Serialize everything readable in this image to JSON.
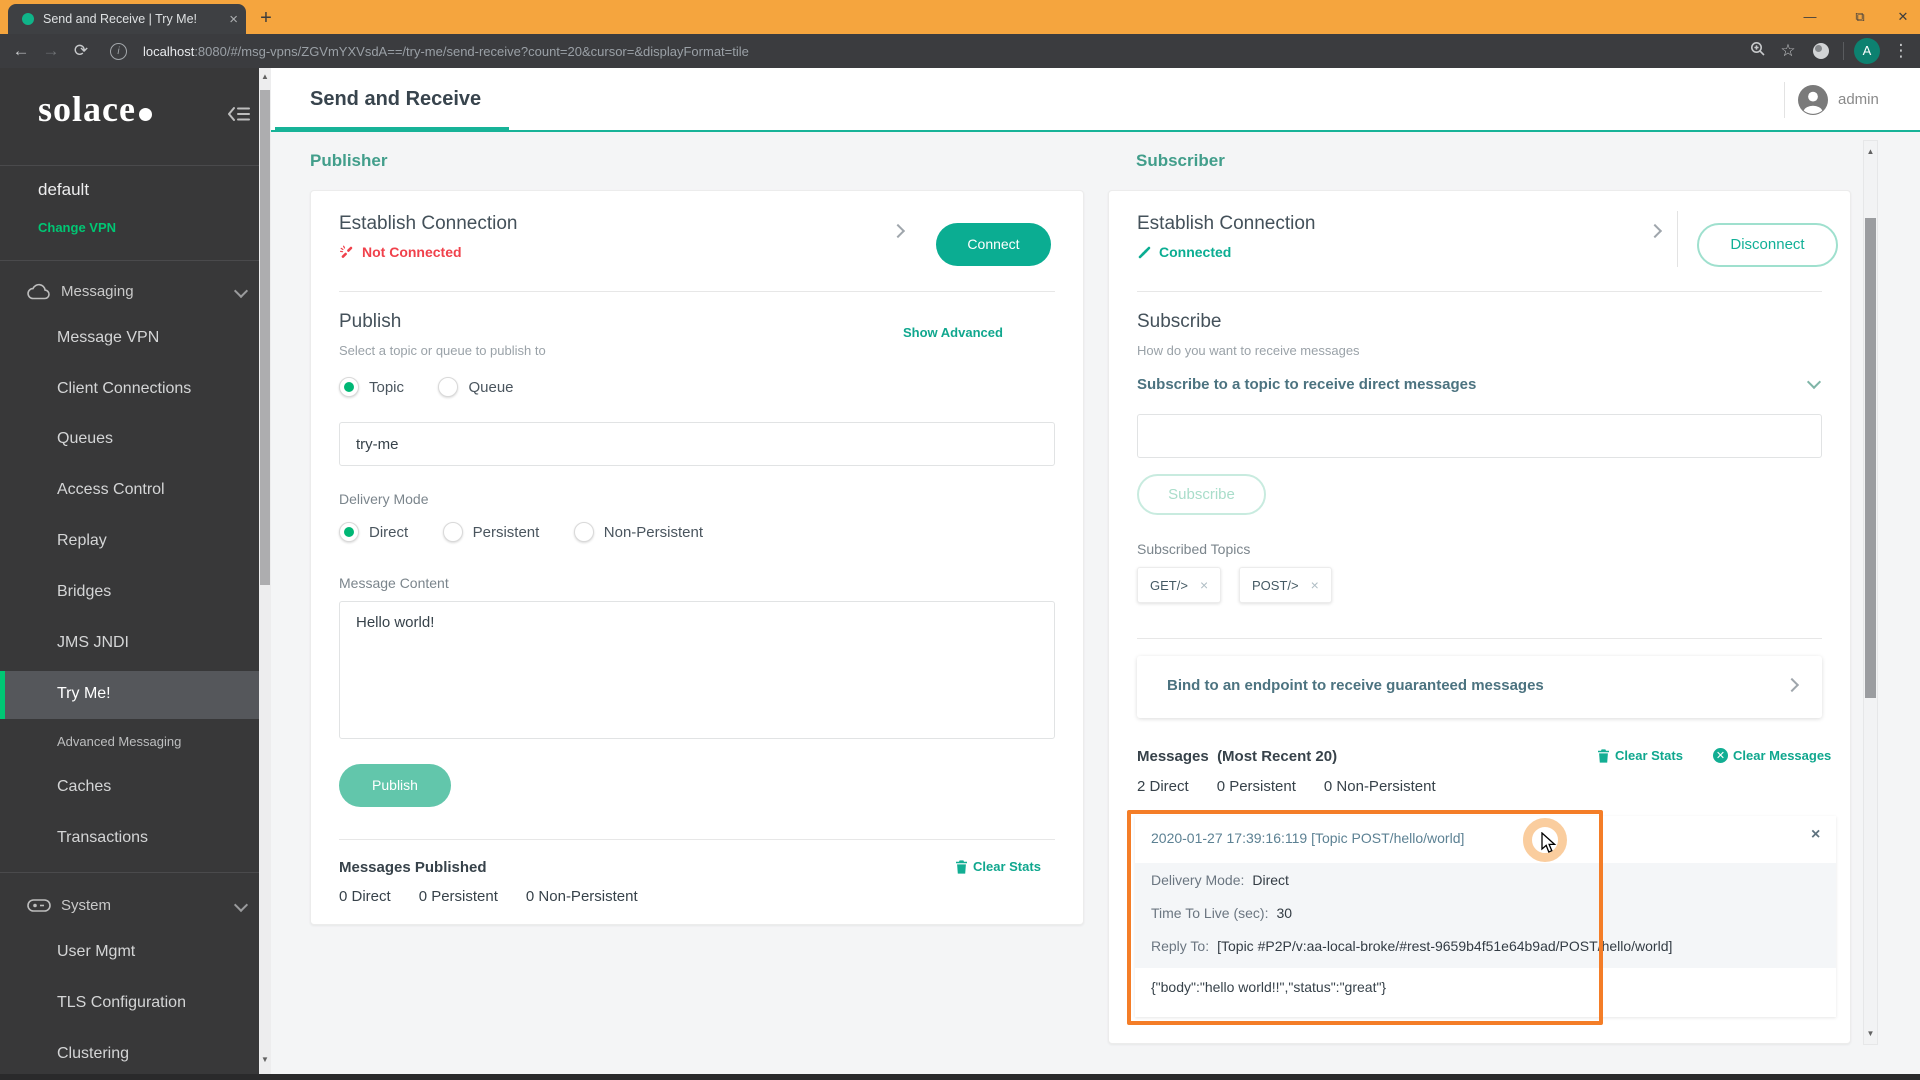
{
  "colors": {
    "accent_teal": "#0BAD92",
    "brand_green": "#00C774",
    "error_red": "#F0414B",
    "highlight_orange": "#F47D27",
    "header_underline": "#17B398",
    "chrome_orange": "#F5A53E"
  },
  "browser": {
    "tab_title": "Send and Receive | Try Me!",
    "url_host": "localhost",
    "url_rest": ":8080/#/msg-vpns/ZGVmYXVsdA==/try-me/send-receive?count=20&cursor=&displayFormat=tile",
    "profile_initial": "A"
  },
  "window_controls": {
    "minimize": "—",
    "maximize": "⧉",
    "close": "✕"
  },
  "icons": {
    "back": "←",
    "forward": "→",
    "reload": "⟳",
    "star": "☆",
    "menu_dots": "⋮",
    "new_tab": "+",
    "tab_close": "×",
    "close_x": "×",
    "scroll_up": "▲",
    "scroll_down": "▼"
  },
  "header": {
    "title": "Send and Receive",
    "user": "admin"
  },
  "sidebar": {
    "logo": "solace",
    "vpn_name": "default",
    "change_vpn": "Change VPN",
    "messaging": {
      "label": "Messaging",
      "items": [
        "Message VPN",
        "Client Connections",
        "Queues",
        "Access Control",
        "Replay",
        "Bridges",
        "JMS JNDI",
        "Try Me!",
        "Advanced Messaging",
        "Caches",
        "Transactions"
      ]
    },
    "system": {
      "label": "System",
      "items": [
        "User Mgmt",
        "TLS Configuration",
        "Clustering"
      ]
    }
  },
  "publisher": {
    "title": "Publisher",
    "connection": {
      "title": "Establish Connection",
      "status": "Not Connected",
      "button": "Connect"
    },
    "publish": {
      "title": "Publish",
      "subtitle": "Select a topic or queue to publish to",
      "show_advanced": "Show Advanced",
      "option_topic": "Topic",
      "option_queue": "Queue",
      "topic_value": "try-me",
      "delivery_label": "Delivery Mode",
      "option_direct": "Direct",
      "option_persistent": "Persistent",
      "option_non_persistent": "Non-Persistent",
      "content_label": "Message Content",
      "content_value": "Hello world!",
      "button": "Publish"
    },
    "stats": {
      "title": "Messages Published",
      "clear": "Clear Stats",
      "items": [
        {
          "count": "0",
          "label": "Direct"
        },
        {
          "count": "0",
          "label": "Persistent"
        },
        {
          "count": "0",
          "label": "Non-Persistent"
        }
      ]
    }
  },
  "subscriber": {
    "title": "Subscriber",
    "connection": {
      "title": "Establish Connection",
      "status": "Connected",
      "button": "Disconnect"
    },
    "subscribe": {
      "title": "Subscribe",
      "subtitle": "How do you want to receive messages",
      "direct_label": "Subscribe to a topic to receive direct messages",
      "input_value": "",
      "button": "Subscribe",
      "topics_label": "Subscribed Topics",
      "topics": [
        "GET/>",
        "POST/>"
      ]
    },
    "bind_label": "Bind to an endpoint to receive guaranteed messages",
    "messages": {
      "title": "Messages",
      "recent": "(Most Recent 20)",
      "clear_stats": "Clear Stats",
      "clear_messages": "Clear Messages",
      "counts": [
        {
          "count": "2",
          "label": "Direct"
        },
        {
          "count": "0",
          "label": "Persistent"
        },
        {
          "count": "0",
          "label": "Non-Persistent"
        }
      ],
      "tile": {
        "header": "2020-01-27 17:39:16:119 [Topic POST/hello/world]",
        "fields": [
          {
            "label": "Delivery Mode:",
            "value": "Direct"
          },
          {
            "label": "Time To Live (sec):",
            "value": "30"
          },
          {
            "label": "Reply To:",
            "value": "[Topic #P2P/v:aa-local-broke/#rest-9659b4f51e64b9ad/POST/hello/world]"
          }
        ],
        "payload": "{\"body\":\"hello world!!\",\"status\":\"great\"}"
      }
    }
  }
}
